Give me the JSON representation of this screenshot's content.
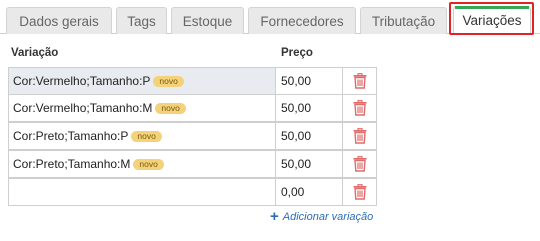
{
  "tabs": [
    {
      "label": "Dados gerais"
    },
    {
      "label": "Tags"
    },
    {
      "label": "Estoque"
    },
    {
      "label": "Fornecedores"
    },
    {
      "label": "Tributação"
    },
    {
      "label": "Variações",
      "active": true
    }
  ],
  "table": {
    "headers": {
      "variation": "Variação",
      "price": "Preço"
    },
    "rows": [
      {
        "variation": "Cor:Vermelho;Tamanho:P",
        "badge": "novo",
        "price": "50,00",
        "selected": true
      },
      {
        "variation": "Cor:Vermelho;Tamanho:M",
        "badge": "novo",
        "price": "50,00"
      },
      {
        "variation": "Cor:Preto;Tamanho:P",
        "badge": "novo",
        "price": "50,00"
      },
      {
        "variation": "Cor:Preto;Tamanho:M",
        "badge": "novo",
        "price": "50,00"
      },
      {
        "variation": "",
        "badge": "",
        "price": "0,00"
      }
    ]
  },
  "add_variation": {
    "label": "Adicionar variação",
    "icon": "plus-icon"
  },
  "colors": {
    "badge": "#f4d27a",
    "trash": "#e06b6b",
    "link": "#2b6cb8",
    "highlight": "#e02424",
    "active_tab_accent": "#34a853"
  }
}
